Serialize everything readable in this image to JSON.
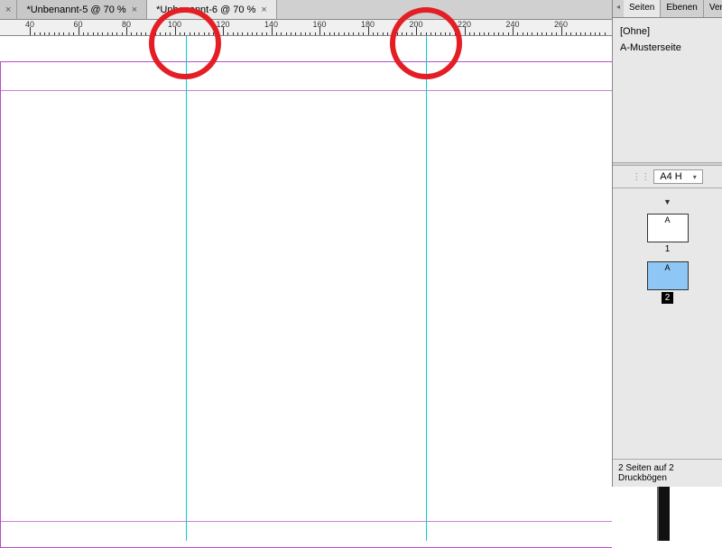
{
  "tabs": {
    "items": [
      {
        "label": "*Unbenannt-5 @ 70 %",
        "active": false
      },
      {
        "label": "*Unbenannt-6 @ 70 %",
        "active": true
      }
    ]
  },
  "ruler": {
    "labels": [
      "40",
      "60",
      "80",
      "100",
      "120",
      "140",
      "160",
      "180",
      "200",
      "220",
      "240",
      "260"
    ],
    "startX": 33,
    "step": 53.5
  },
  "panel": {
    "tabs": [
      {
        "label": "Seiten",
        "active": true
      },
      {
        "label": "Ebenen",
        "active": false
      },
      {
        "label": "Verkn",
        "active": false
      }
    ],
    "masters": [
      {
        "label": "[Ohne]"
      },
      {
        "label": "A-Musterseite"
      }
    ],
    "pageSize": "A4 H",
    "pages": [
      {
        "master": "A",
        "number": "1",
        "selected": false,
        "current": false
      },
      {
        "master": "A",
        "number": "2",
        "selected": true,
        "current": true
      }
    ],
    "footer": "2 Seiten auf 2 Druckbögen"
  }
}
